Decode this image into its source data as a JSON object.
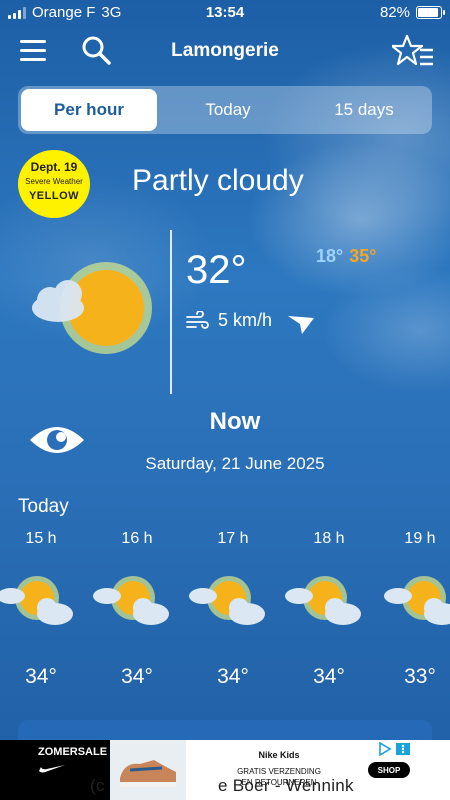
{
  "status_bar": {
    "carrier": "Orange F",
    "network": "3G",
    "time": "13:54",
    "battery": "82%",
    "battery_level": 0.82
  },
  "header": {
    "title": "Lamongerie",
    "menu_icon": "hamburger-menu-icon",
    "search_icon": "search-icon",
    "favorites_icon": "star-list-icon"
  },
  "tabs": [
    {
      "label": "Per hour",
      "active": true
    },
    {
      "label": "Today",
      "active": false
    },
    {
      "label": "15 days",
      "active": false
    }
  ],
  "alert": {
    "line1": "Dept. 19",
    "line2": "Severe Weather",
    "line3": "YELLOW",
    "color": "#fff200"
  },
  "current": {
    "condition": "Partly cloudy",
    "temperature": "32°",
    "min": "18°",
    "max": "35°",
    "wind": "5 km/h",
    "label": "Now",
    "date": "Saturday, 21 June 2025"
  },
  "colors": {
    "min_temp": "#9fd3ff",
    "max_temp": "#f6a623",
    "sun": "#f6b21b",
    "active_tab_text": "#1f5c9a"
  },
  "hourly": {
    "label": "Today",
    "items": [
      {
        "hour": "15 h",
        "temp": "34°",
        "icon": "partly-cloudy-icon"
      },
      {
        "hour": "16 h",
        "temp": "34°",
        "icon": "partly-cloudy-icon"
      },
      {
        "hour": "17 h",
        "temp": "34°",
        "icon": "partly-cloudy-icon"
      },
      {
        "hour": "18 h",
        "temp": "34°",
        "icon": "partly-cloudy-icon"
      },
      {
        "hour": "19 h",
        "temp": "33°",
        "icon": "partly-cloudy-icon"
      }
    ]
  },
  "ad": {
    "promo": "ZOMERSALE",
    "brand": "Nike Kids",
    "line1": "GRATIS VERZENDING",
    "line2": "EN RETOURNEREN",
    "cta": "SHOP"
  },
  "copyright": {
    "pre": "(c",
    "post": "e Boer - Wennink"
  }
}
